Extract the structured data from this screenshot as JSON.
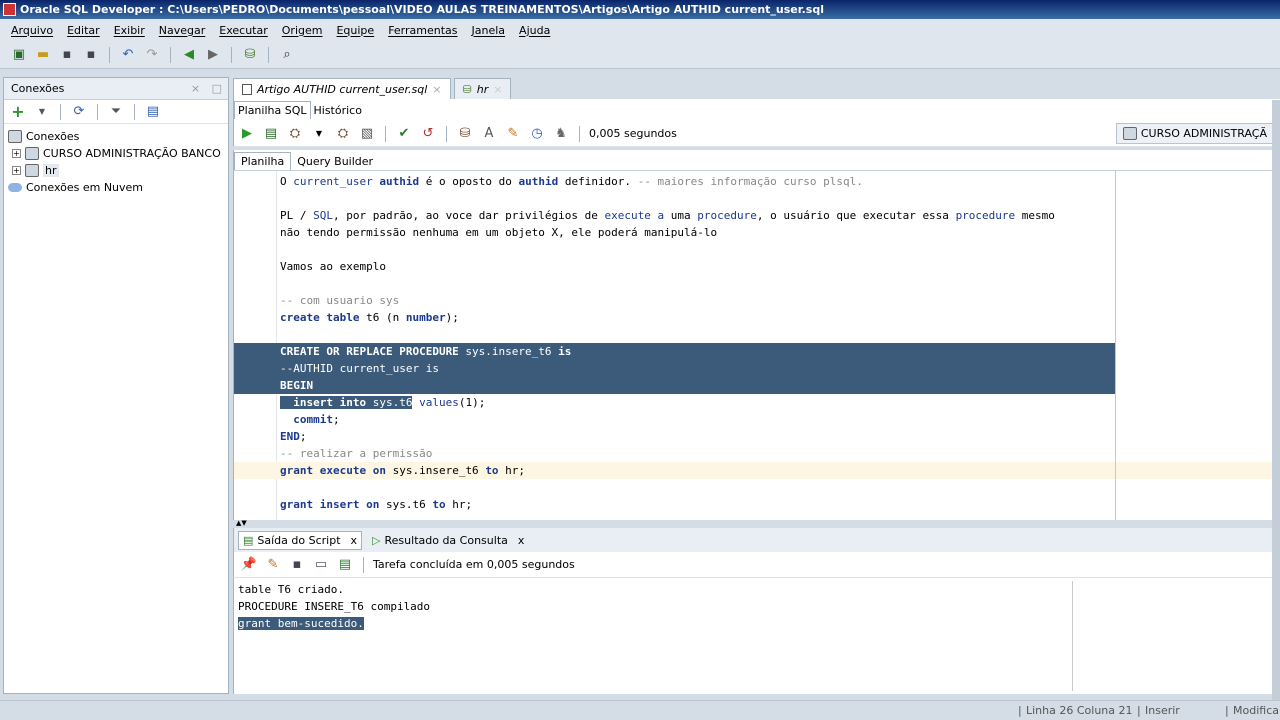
{
  "window": {
    "title": "Oracle SQL Developer : C:\\Users\\PEDRO\\Documents\\pessoal\\VIDEO AULAS TREINAMENTOS\\Artigos\\Artigo AUTHID current_user.sql"
  },
  "menu": [
    "Arquivo",
    "Editar",
    "Exibir",
    "Navegar",
    "Executar",
    "Origem",
    "Equipe",
    "Ferramentas",
    "Janela",
    "Ajuda"
  ],
  "connections_panel": {
    "title": "Conexões",
    "close": "×",
    "minimize": "□",
    "tree": [
      {
        "label": "Conexões"
      },
      {
        "label": "CURSO ADMINISTRAÇÃO BANCO"
      },
      {
        "label": "hr"
      },
      {
        "label": "Conexões em Nuvem"
      }
    ]
  },
  "editor_tabs": [
    {
      "label": "Artigo AUTHID current_user.sql"
    },
    {
      "label": "hr"
    }
  ],
  "sql_tabs": {
    "worksheet": "Planilha SQL",
    "history": "Histórico"
  },
  "exec_time": "0,005 segundos",
  "connection_combo": "CURSO ADMINISTRAÇÃ",
  "sub_tabs": {
    "worksheet": "Planilha",
    "query_builder": "Query Builder"
  },
  "output_tabs": {
    "script_output": "Saída do Script",
    "query_result": "Resultado da Consulta",
    "close": "x"
  },
  "output_status": "Tarefa concluída em 0,005 segundos",
  "output_lines": [
    "table T6 criado.",
    "PROCEDURE INSERE_T6 compilado",
    "grant bem-sucedido."
  ],
  "statusbar": {
    "position": "Linha 26 Coluna 21",
    "mode": "Inserir",
    "modified": "Modifica"
  }
}
